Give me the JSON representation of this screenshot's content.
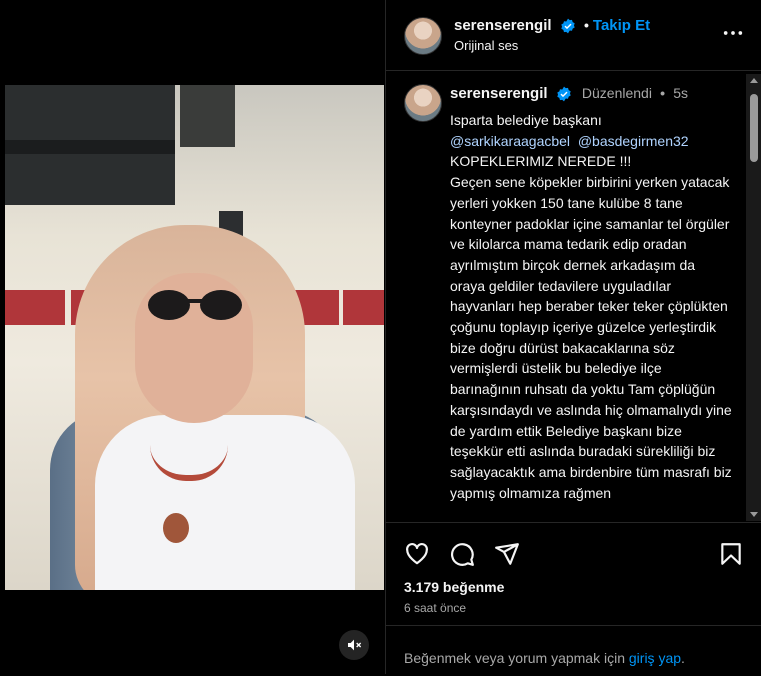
{
  "header": {
    "username": "serenserengil",
    "separator": "•",
    "follow_label": "Takip Et",
    "audio": "Orijinal ses",
    "more_icon": "more-horizontal-icon"
  },
  "caption": {
    "username": "serenserengil",
    "edited": "Düzenlendi",
    "separator": "•",
    "time": "5s",
    "line1": "Isparta belediye başkanı",
    "mention1": "@sarkikaraagacbel",
    "mention2": "@basdegirmen32",
    "body": "KOPEKLERIMIZ NEREDE !!!\nGeçen sene köpekler birbirini yerken yatacak yerleri yokken 150 tane kulübe 8 tane konteyner padoklar içine samanlar tel örgüler ve kilolarca mama tedarik edip oradan ayrılmıştım birçok dernek arkadaşım da oraya geldiler tedavilere uyguladılar hayvanları hep beraber teker teker çöplükten çoğunu toplayıp içeriye güzelce yerleştirdik bize doğru dürüst bakacaklarına söz vermişlerdi üstelik bu belediye ilçe barınağının ruhsatı da yoktu Tam çöplüğün karşısındaydı ve aslında hiç olmamalıydı yine de yardım ettik Belediye başkanı bize teşekkür etti aslında buradaki sürekliliği biz sağlayacaktık ama birdenbire tüm masrafı biz yapmış olmamıza rağmen"
  },
  "actions": {
    "like_icon": "heart-icon",
    "comment_icon": "comment-icon",
    "share_icon": "share-icon",
    "save_icon": "bookmark-icon",
    "likes": "3.179 beğenme",
    "ago": "6 saat önce"
  },
  "login": {
    "text": "Beğenmek veya yorum yapmak için",
    "link": "giriş yap",
    "suffix": "."
  },
  "media": {
    "mute_icon": "muted-speaker-icon"
  },
  "colors": {
    "accent": "#0095f6",
    "background": "#000000",
    "text": "#f5f5f5",
    "muted": "#a8a8a8",
    "verified": "#0095f6"
  }
}
